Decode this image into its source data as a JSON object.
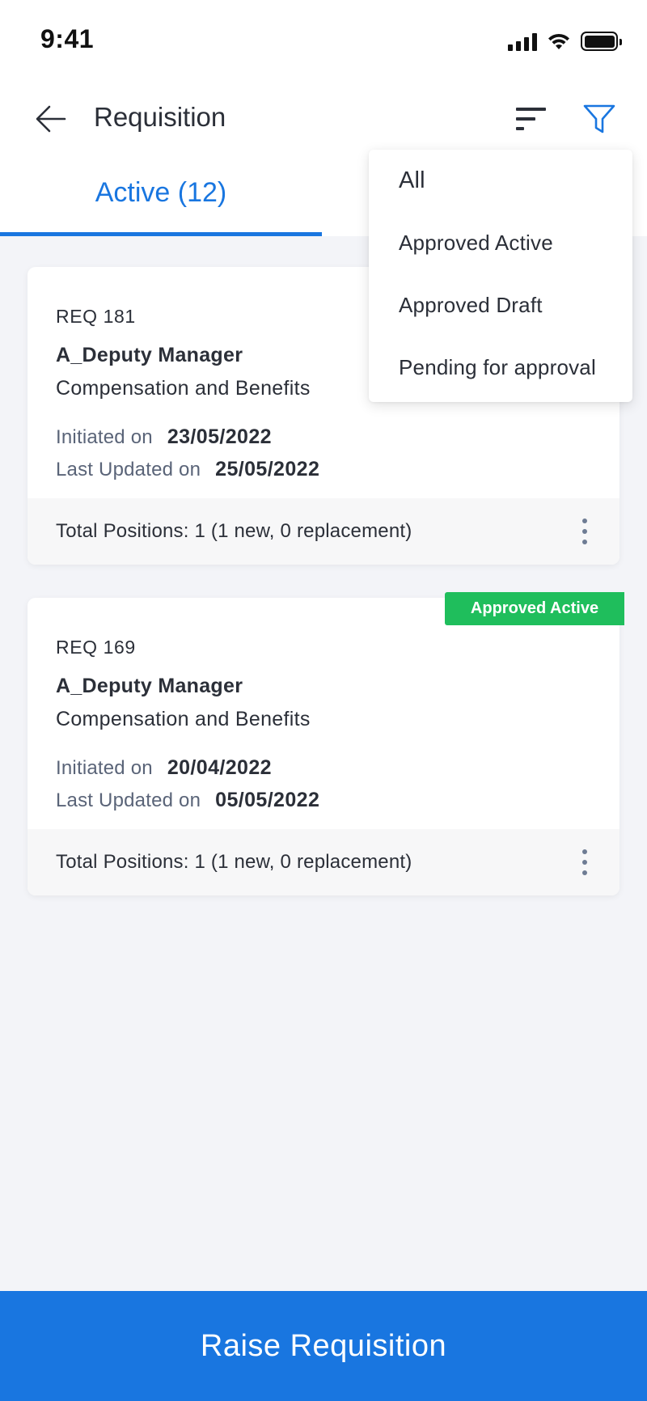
{
  "status_bar": {
    "time": "9:41",
    "icons": [
      "signal-icon",
      "wifi-icon",
      "battery-icon"
    ]
  },
  "header": {
    "title": "Requisition",
    "back_icon": "arrow-left-icon",
    "sort_icon": "sort-icon",
    "filter_icon": "filter-icon"
  },
  "tabs": {
    "active_label": "Active (12)"
  },
  "filter_menu": {
    "items": [
      "All",
      "Approved Active",
      "Approved Draft",
      "Pending for approval"
    ]
  },
  "cards": [
    {
      "req_id": "REQ 181",
      "role": "A_Deputy Manager",
      "department": "Compensation and Benefits",
      "initiated_label": "Initiated on",
      "initiated_date": "23/05/2022",
      "updated_label": "Last Updated on",
      "updated_date": "25/05/2022",
      "positions": "Total Positions: 1 (1 new, 0 replacement)"
    },
    {
      "req_id": "REQ 169",
      "role": "A_Deputy Manager",
      "department": "Compensation and Benefits",
      "initiated_label": "Initiated on",
      "initiated_date": "20/04/2022",
      "updated_label": "Last Updated on",
      "updated_date": "05/05/2022",
      "positions": "Total Positions: 1 (1 new, 0 replacement)",
      "status": "Approved Active"
    }
  ],
  "footer": {
    "raise_label": "Raise Requisition"
  },
  "colors": {
    "primary": "#1976e0",
    "badge_green": "#1fbe5c",
    "background": "#f3f4f8"
  }
}
